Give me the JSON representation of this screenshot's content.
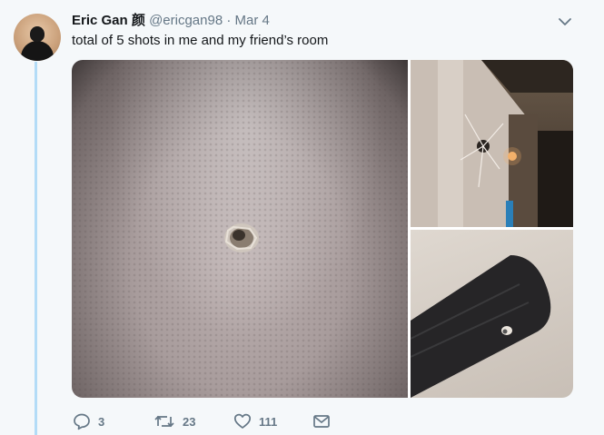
{
  "tweet": {
    "author_name": "Eric Gan",
    "author_glyph": "颜",
    "author_handle": "@ericgan98",
    "separator": "·",
    "date": "Mar 4",
    "text": "total of 5 shots in me and my friend’s room"
  },
  "media": {
    "photos": [
      {
        "subject": "bullet hole in textured white wall"
      },
      {
        "subject": "cracked bullet hole in window, dark room"
      },
      {
        "subject": "bullet hole in ceiling fan blade"
      }
    ]
  },
  "actions": {
    "reply_count": "3",
    "retweet_count": "23",
    "like_count": "111"
  },
  "icons": {
    "reply": "reply-icon",
    "retweet": "retweet-icon",
    "like": "heart-icon",
    "message": "envelope-icon",
    "menu": "chevron-down-icon"
  },
  "colors": {
    "background": "#f5f8fa",
    "text": "#14171a",
    "muted": "#657786",
    "thread_line": "#b3dcf7"
  }
}
